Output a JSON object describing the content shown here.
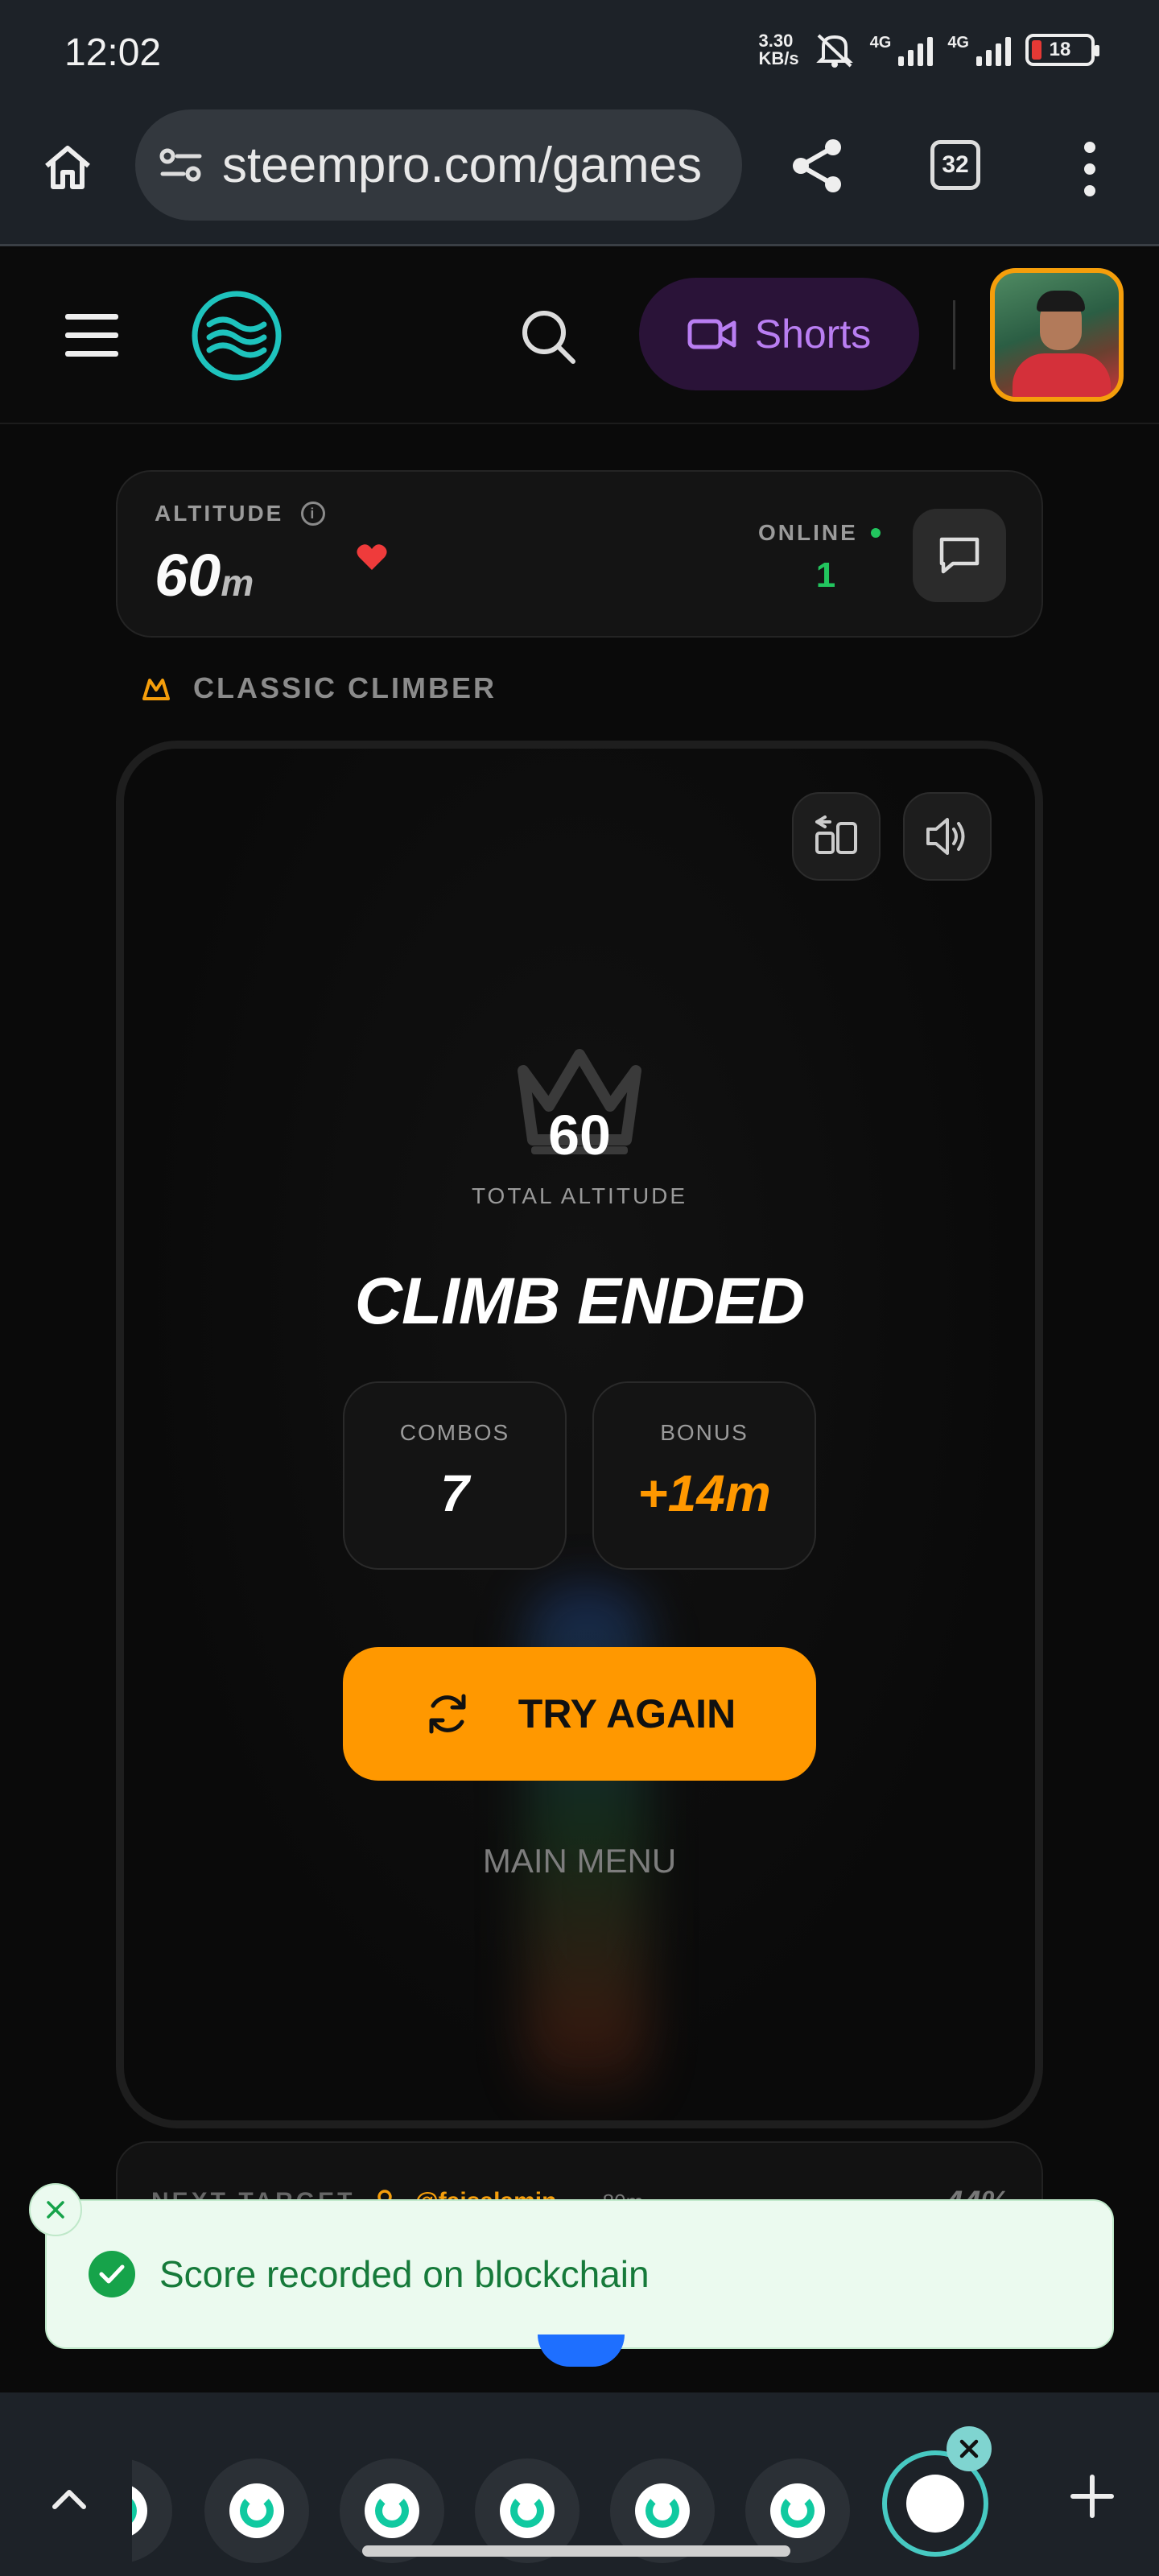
{
  "status_bar": {
    "time": "12:02",
    "net_speed_value": "3.30",
    "net_speed_unit": "KB/s",
    "sim1": "4G",
    "sim2": "4G",
    "battery": "18"
  },
  "browser": {
    "url": "steempro.com/games",
    "tab_count": "32"
  },
  "header": {
    "shorts_label": "Shorts"
  },
  "stats_bar": {
    "altitude_label": "ALTITUDE",
    "altitude_value": "60",
    "altitude_unit": "m",
    "online_label": "ONLINE",
    "online_count": "1"
  },
  "game": {
    "mode_label": "CLASSIC CLIMBER",
    "score": "60",
    "score_label": "TOTAL ALTITUDE",
    "title": "CLIMB ENDED",
    "combos_label": "COMBOS",
    "combos_value": "7",
    "bonus_label": "BONUS",
    "bonus_value": "+14m",
    "try_again_label": "TRY AGAIN",
    "main_menu_label": "MAIN MENU"
  },
  "next_target": {
    "label": "NEXT TARGET",
    "user": "@faisalamin",
    "altitude": "— 80m",
    "progress": "44%"
  },
  "toast": {
    "message": "Score recorded on blockchain"
  },
  "colors": {
    "accent_orange": "#ff9800",
    "online_green": "#22c55e",
    "shorts_purple": "#b97ef2",
    "toast_green": "#167a3a"
  }
}
